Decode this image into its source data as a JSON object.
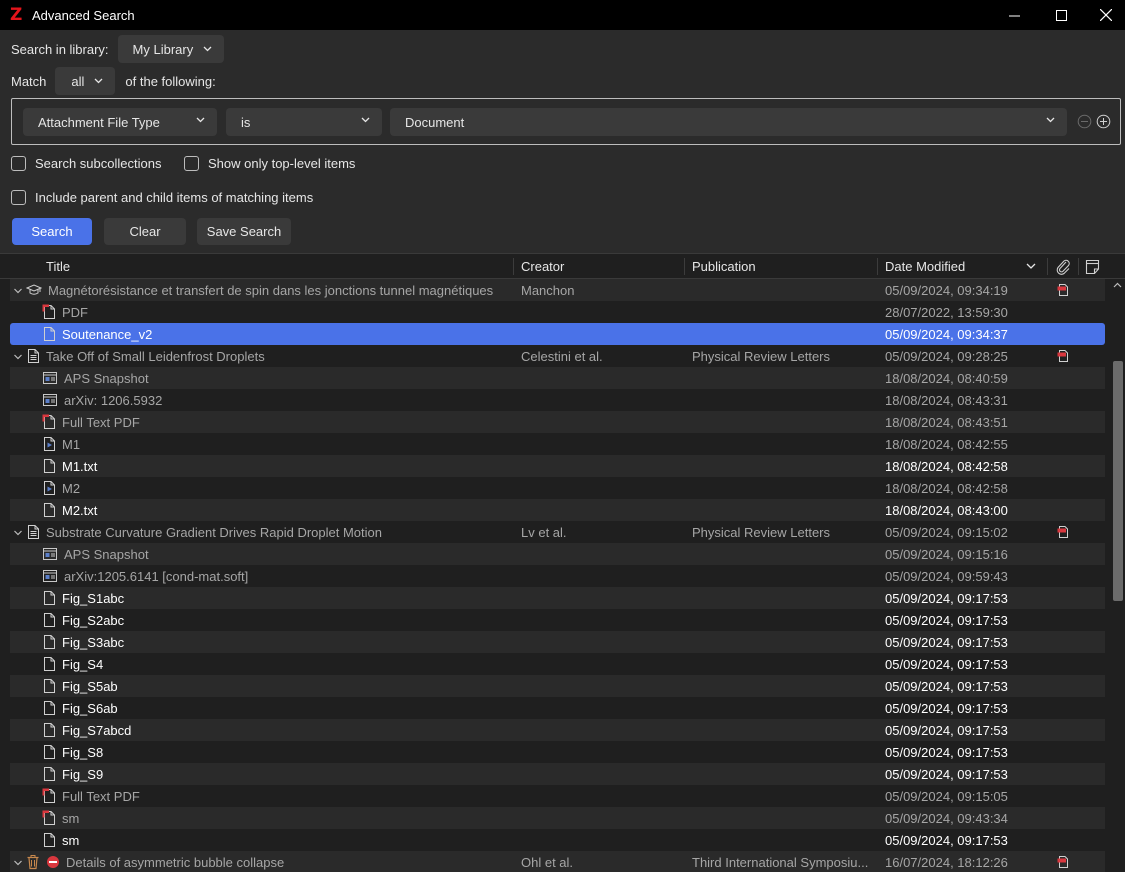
{
  "window": {
    "title": "Advanced Search"
  },
  "search": {
    "library_label": "Search in library:",
    "library_value": "My Library",
    "match_label": "Match",
    "match_value": "all",
    "match_suffix": "of the following:",
    "condition": {
      "field": "Attachment File Type",
      "operator": "is",
      "value": "Document"
    },
    "options": {
      "subcollections": "Search subcollections",
      "top_level": "Show only top-level items",
      "parent_child": "Include parent and child items of matching items"
    },
    "buttons": {
      "search": "Search",
      "clear": "Clear",
      "save": "Save Search"
    }
  },
  "table": {
    "columns": {
      "title": "Title",
      "creator": "Creator",
      "publication": "Publication",
      "date": "Date Modified"
    },
    "rows": [
      {
        "level": 0,
        "twisty": true,
        "icon": "thesis-icon",
        "title": "Magnétorésistance et transfert de spin dans les jonctions tunnel magnétiques",
        "creator": "Manchon",
        "publication": "",
        "date": "05/09/2024, 09:34:19",
        "pdf": true,
        "tone": "dim"
      },
      {
        "level": 1,
        "icon": "pdf-icon",
        "title": "PDF",
        "creator": "",
        "publication": "",
        "date": "28/07/2022, 13:59:30",
        "tone": "dim"
      },
      {
        "level": 1,
        "icon": "document-icon",
        "title": "Soutenance_v2",
        "creator": "",
        "publication": "",
        "date": "05/09/2024, 09:34:37",
        "tone": "bright",
        "selected": true
      },
      {
        "level": 0,
        "twisty": true,
        "icon": "article-icon",
        "title": "Take Off of Small Leidenfrost Droplets",
        "creator": "Celestini et al.",
        "publication": "Physical Review Letters",
        "date": "05/09/2024, 09:28:25",
        "pdf": true,
        "tone": "dim"
      },
      {
        "level": 1,
        "icon": "snapshot-icon",
        "title": "APS Snapshot",
        "creator": "",
        "publication": "",
        "date": "18/08/2024, 08:40:59",
        "tone": "dim"
      },
      {
        "level": 1,
        "icon": "snapshot-icon",
        "title": "arXiv: 1206.5932",
        "creator": "",
        "publication": "",
        "date": "18/08/2024, 08:43:31",
        "tone": "dim"
      },
      {
        "level": 1,
        "icon": "pdf-icon",
        "title": "Full Text PDF",
        "creator": "",
        "publication": "",
        "date": "18/08/2024, 08:43:51",
        "tone": "dim"
      },
      {
        "level": 1,
        "icon": "video-icon",
        "title": "M1",
        "creator": "",
        "publication": "",
        "date": "18/08/2024, 08:42:55",
        "tone": "dim"
      },
      {
        "level": 1,
        "icon": "document-icon",
        "title": "M1.txt",
        "creator": "",
        "publication": "",
        "date": "18/08/2024, 08:42:58",
        "tone": "bright"
      },
      {
        "level": 1,
        "icon": "video-icon",
        "title": "M2",
        "creator": "",
        "publication": "",
        "date": "18/08/2024, 08:42:58",
        "tone": "dim"
      },
      {
        "level": 1,
        "icon": "document-icon",
        "title": "M2.txt",
        "creator": "",
        "publication": "",
        "date": "18/08/2024, 08:43:00",
        "tone": "bright"
      },
      {
        "level": 0,
        "twisty": true,
        "icon": "article-icon",
        "title": "Substrate Curvature Gradient Drives Rapid Droplet Motion",
        "creator": "Lv et al.",
        "publication": "Physical Review Letters",
        "date": "05/09/2024, 09:15:02",
        "pdf": true,
        "tone": "dim"
      },
      {
        "level": 1,
        "icon": "snapshot-icon",
        "title": "APS Snapshot",
        "creator": "",
        "publication": "",
        "date": "05/09/2024, 09:15:16",
        "tone": "dim"
      },
      {
        "level": 1,
        "icon": "snapshot-icon",
        "title": "arXiv:1205.6141 [cond-mat.soft]",
        "creator": "",
        "publication": "",
        "date": "05/09/2024, 09:59:43",
        "tone": "dim"
      },
      {
        "level": 1,
        "icon": "document-icon",
        "title": "Fig_S1abc",
        "creator": "",
        "publication": "",
        "date": "05/09/2024, 09:17:53",
        "tone": "bright"
      },
      {
        "level": 1,
        "icon": "document-icon",
        "title": "Fig_S2abc",
        "creator": "",
        "publication": "",
        "date": "05/09/2024, 09:17:53",
        "tone": "bright"
      },
      {
        "level": 1,
        "icon": "document-icon",
        "title": "Fig_S3abc",
        "creator": "",
        "publication": "",
        "date": "05/09/2024, 09:17:53",
        "tone": "bright"
      },
      {
        "level": 1,
        "icon": "document-icon",
        "title": "Fig_S4",
        "creator": "",
        "publication": "",
        "date": "05/09/2024, 09:17:53",
        "tone": "bright"
      },
      {
        "level": 1,
        "icon": "document-icon",
        "title": "Fig_S5ab",
        "creator": "",
        "publication": "",
        "date": "05/09/2024, 09:17:53",
        "tone": "bright"
      },
      {
        "level": 1,
        "icon": "document-icon",
        "title": "Fig_S6ab",
        "creator": "",
        "publication": "",
        "date": "05/09/2024, 09:17:53",
        "tone": "bright"
      },
      {
        "level": 1,
        "icon": "document-icon",
        "title": "Fig_S7abcd",
        "creator": "",
        "publication": "",
        "date": "05/09/2024, 09:17:53",
        "tone": "bright"
      },
      {
        "level": 1,
        "icon": "document-icon",
        "title": "Fig_S8",
        "creator": "",
        "publication": "",
        "date": "05/09/2024, 09:17:53",
        "tone": "bright"
      },
      {
        "level": 1,
        "icon": "document-icon",
        "title": "Fig_S9",
        "creator": "",
        "publication": "",
        "date": "05/09/2024, 09:17:53",
        "tone": "bright"
      },
      {
        "level": 1,
        "icon": "pdf-icon",
        "title": "Full Text PDF",
        "creator": "",
        "publication": "",
        "date": "05/09/2024, 09:15:05",
        "tone": "dim"
      },
      {
        "level": 1,
        "icon": "pdf-icon",
        "title": "sm",
        "creator": "",
        "publication": "",
        "date": "05/09/2024, 09:43:34",
        "tone": "dim"
      },
      {
        "level": 1,
        "icon": "document-icon",
        "title": "sm",
        "creator": "",
        "publication": "",
        "date": "05/09/2024, 09:17:53",
        "tone": "bright"
      },
      {
        "level": 0,
        "twisty": true,
        "icon": "trash-icon",
        "extra_icon": "blocked-icon",
        "title": "Details of asymmetric bubble collapse",
        "creator": "Ohl et al.",
        "publication": "Third International Symposiu...",
        "date": "16/07/2024, 18:12:26",
        "pdf": true,
        "tone": "dim"
      }
    ]
  },
  "colors": {
    "accent": "#4a72e8",
    "pdf_red": "#d9373e",
    "background": "#1f1f1f",
    "panel": "#2b2b2b"
  }
}
